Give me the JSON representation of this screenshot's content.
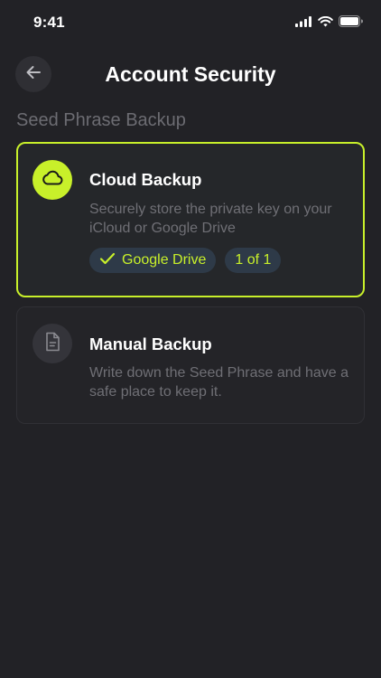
{
  "status_bar": {
    "time": "9:41"
  },
  "header": {
    "title": "Account Security",
    "back_icon": "arrow-left-icon"
  },
  "section": {
    "title": "Seed Phrase Backup"
  },
  "cards": [
    {
      "title": "Cloud Backup",
      "description": "Securely store the private key on your iCloud or Google Drive",
      "icon": "cloud-icon",
      "selected": true,
      "chips": [
        {
          "label": "Google Drive",
          "icon": "check-icon"
        },
        {
          "label": "1 of 1"
        }
      ]
    },
    {
      "title": "Manual Backup",
      "description": "Write down the Seed Phrase and have a safe place to keep it.",
      "icon": "document-icon",
      "selected": false
    }
  ],
  "colors": {
    "accent": "#c8f02a",
    "background": "#222226",
    "chip_background": "#2e3a48",
    "muted_text": "#6f6f75"
  }
}
